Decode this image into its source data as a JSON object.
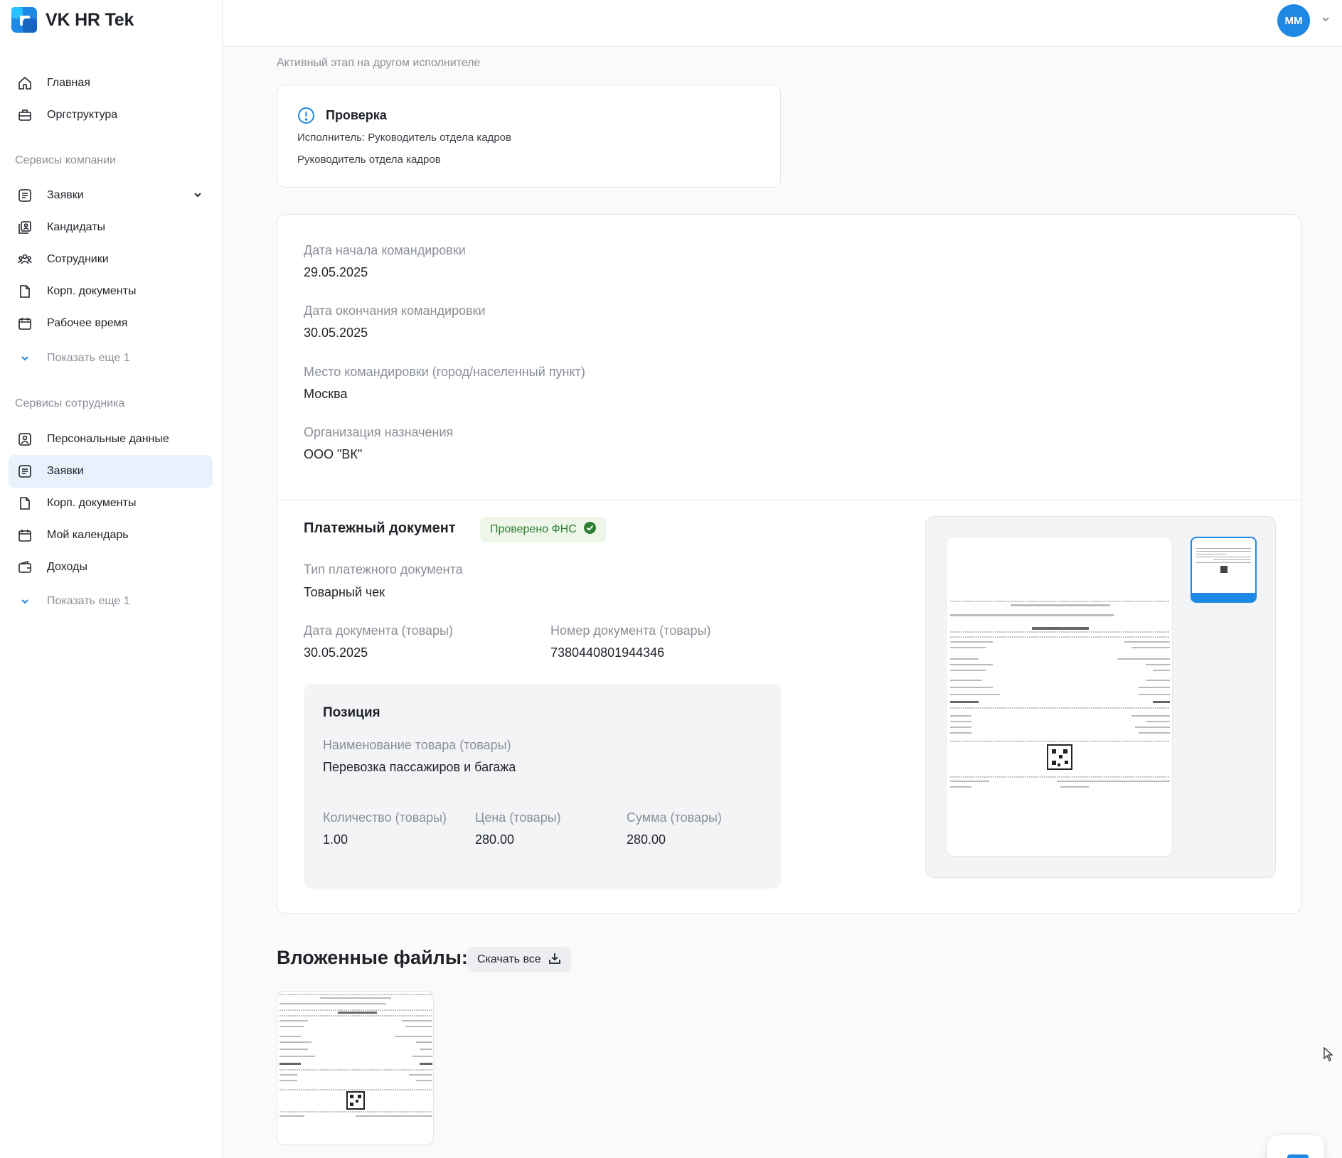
{
  "app": {
    "title": "VK HR Tek",
    "user_initials": "MM"
  },
  "sidebar": {
    "top_items": [
      {
        "label": "Главная",
        "icon": "home-icon"
      },
      {
        "label": "Оргструктура",
        "icon": "briefcase-icon"
      }
    ],
    "company_section": "Сервисы компании",
    "company_items": [
      {
        "label": "Заявки",
        "icon": "list-icon"
      },
      {
        "label": "Кандидаты",
        "icon": "candidates-icon"
      },
      {
        "label": "Сотрудники",
        "icon": "users-icon"
      },
      {
        "label": "Корп. документы",
        "icon": "document-icon"
      },
      {
        "label": "Рабочее время",
        "icon": "calendar-icon"
      }
    ],
    "company_more": "Показать еще 1",
    "employee_section": "Сервисы сотрудника",
    "employee_items": [
      {
        "label": "Персональные данные",
        "icon": "person-card-icon"
      },
      {
        "label": "Заявки",
        "icon": "list-icon",
        "active": true
      },
      {
        "label": "Корп. документы",
        "icon": "document-icon"
      },
      {
        "label": "Мой календарь",
        "icon": "calendar-icon"
      },
      {
        "label": "Доходы",
        "icon": "wallet-icon"
      }
    ],
    "employee_more": "Показать еще 1"
  },
  "main": {
    "stage_subtitle": "Активный этап на другом исполнителе",
    "stage": {
      "title": "Проверка",
      "executor": "Исполнитель: Руководитель отдела кадров",
      "role": "Руководитель отдела кадров"
    },
    "trip": {
      "start_label": "Дата начала командировки",
      "start_value": "29.05.2025",
      "end_label": "Дата окончания командировки",
      "end_value": "30.05.2025",
      "place_label": "Место командировки (город/населенный пункт)",
      "place_value": "Москва",
      "org_label": "Организация назначения",
      "org_value": "ООО \"ВК\""
    },
    "payment": {
      "title": "Платежный документ",
      "badge": "Проверено ФНС",
      "type_label": "Тип платежного документа",
      "type_value": "Товарный чек",
      "date_label": "Дата документа (товары)",
      "date_value": "30.05.2025",
      "number_label": "Номер документа (товары)",
      "number_value": "7380440801944346",
      "position": {
        "title": "Позиция",
        "name_label": "Наименование товара (товары)",
        "name_value": "Перевозка пассажиров и багажа",
        "qty_label": "Количество (товары)",
        "qty_value": "1.00",
        "price_label": "Цена (товары)",
        "price_value": "280.00",
        "sum_label": "Сумма (товары)",
        "sum_value": "280.00"
      }
    },
    "files": {
      "title": "Вложенные файлы:",
      "download_all": "Скачать все"
    }
  },
  "colors": {
    "accent": "#1e88e5",
    "active_bg": "#e9f1fd",
    "badge_bg": "#edf6e8",
    "badge_text": "#2e7d32",
    "muted": "#8a8f98"
  }
}
